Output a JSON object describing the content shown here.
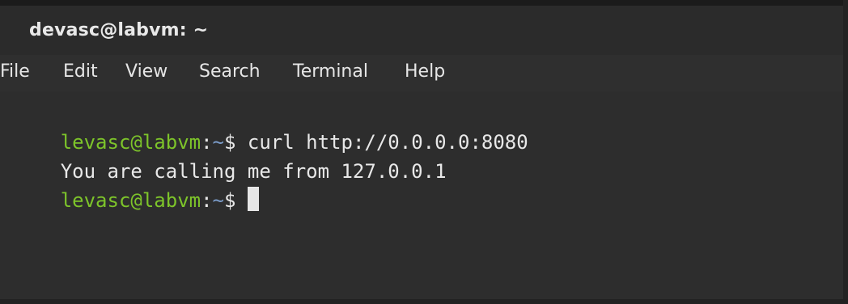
{
  "window": {
    "title": "devasc@labvm: ~"
  },
  "menu": {
    "items": [
      "File",
      "Edit",
      "View",
      "Search",
      "Terminal",
      "Help"
    ]
  },
  "terminal": {
    "line1": {
      "user": "levasc@labvm",
      "separator": ":",
      "path": "~",
      "symbol": "$ ",
      "command": "curl http://0.0.0.0:8080"
    },
    "line2": {
      "output": "You are calling me from 127.0.0.1"
    },
    "line3": {
      "user": "levasc@labvm",
      "separator": ":",
      "path": "~",
      "symbol": "$ "
    }
  },
  "colors": {
    "background": "#2d2d2d",
    "prompt_user": "#7dc42a",
    "prompt_path": "#7a9bc8",
    "text": "#e8e8e8"
  }
}
